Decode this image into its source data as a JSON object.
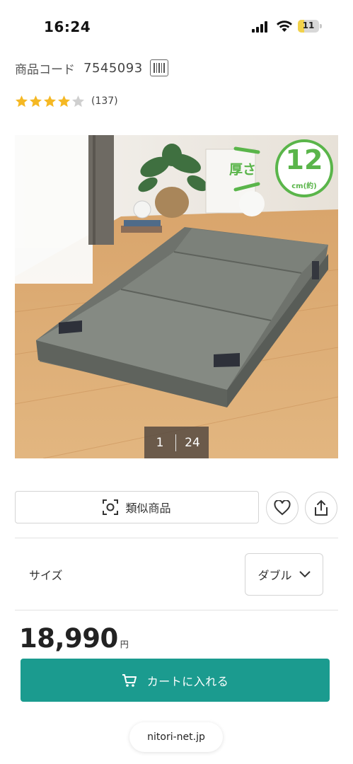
{
  "status_bar": {
    "time": "16:24",
    "battery_level": "11",
    "icons": [
      "signal-icon",
      "wifi-icon",
      "battery-icon"
    ]
  },
  "product": {
    "code_label": "商品コード",
    "code_value": "7545093",
    "rating": 4,
    "rating_max": 5,
    "review_count": "(137)",
    "image_badge": {
      "thickness_label": "厚さ",
      "thickness_value": "12",
      "thickness_unit": "cm(約)"
    },
    "image_counter": {
      "current": "1",
      "total": "24"
    }
  },
  "actions": {
    "similar_label": "類似商品",
    "favorite_icon": "heart-icon",
    "share_icon": "share-icon"
  },
  "size": {
    "label": "サイズ",
    "selected": "ダブル"
  },
  "price": {
    "value": "18,990",
    "unit": "円"
  },
  "cart": {
    "label": "カートに入れる"
  },
  "browser": {
    "url": "nitori-net.jp"
  },
  "colors": {
    "accent": "#1b9b8f",
    "star": "#f5b823",
    "star_empty": "#cfcfcf",
    "badge_green": "#5ab54a"
  }
}
